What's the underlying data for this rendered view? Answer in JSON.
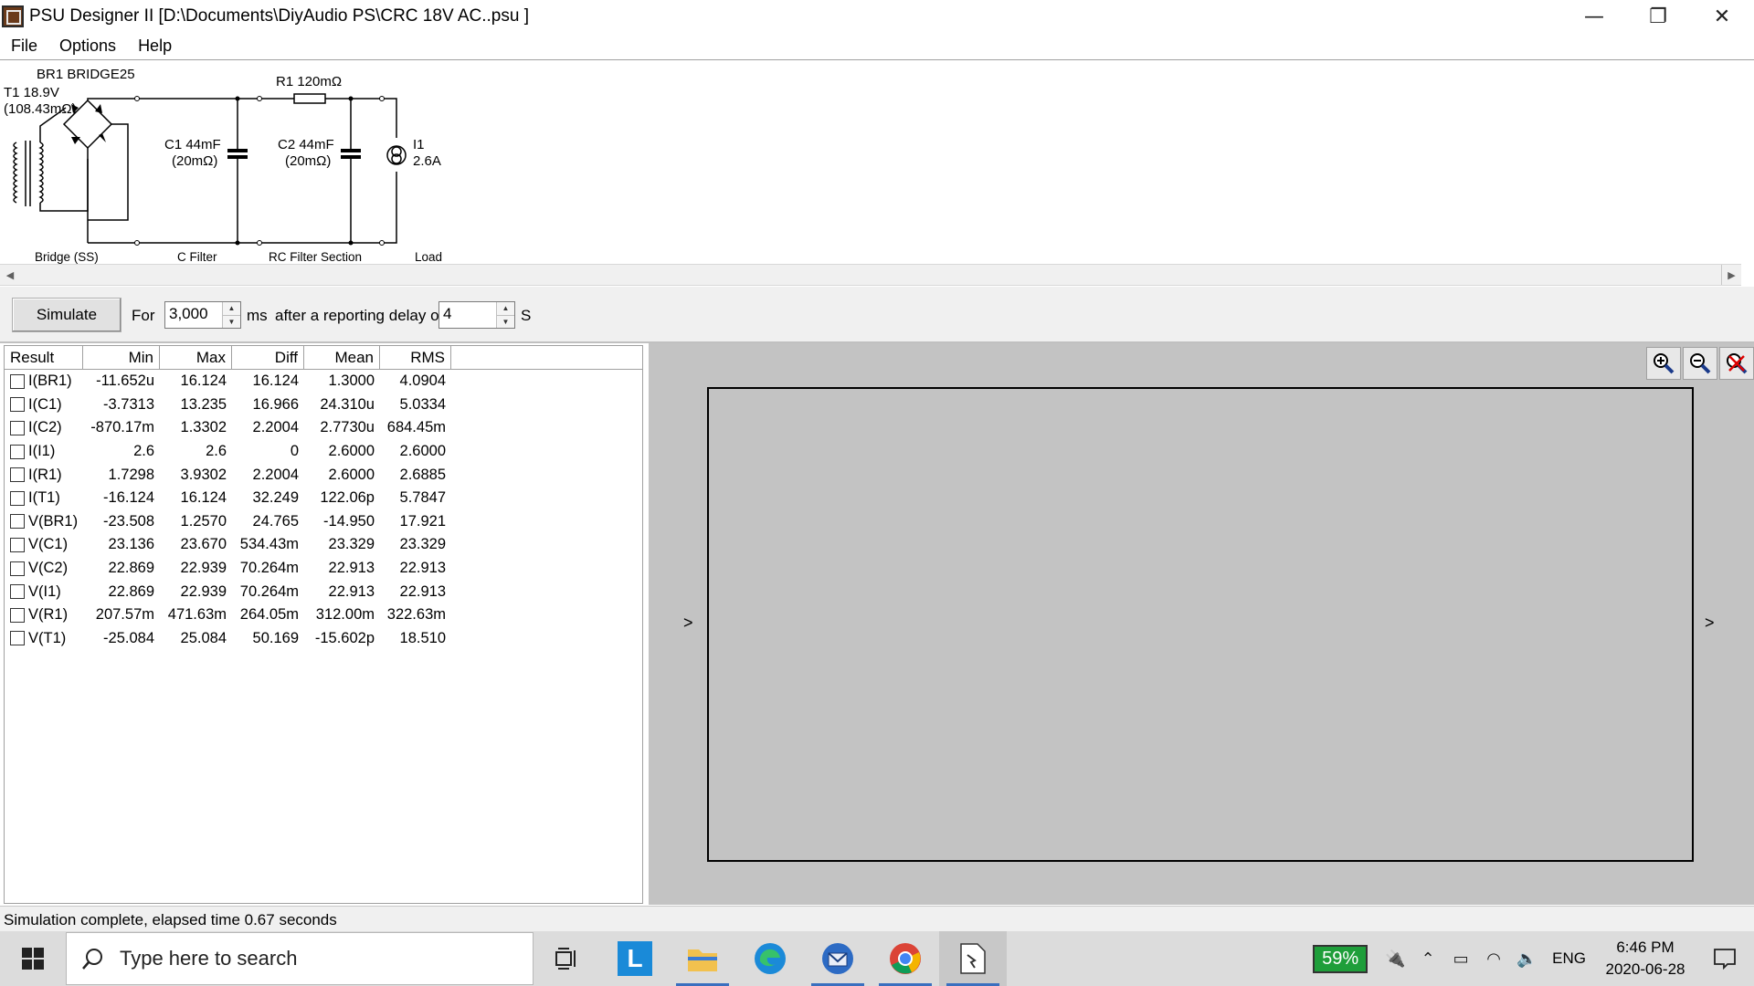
{
  "window": {
    "title": "PSU Designer II  [D:\\Documents\\DiyAudio PS\\CRC 18V AC..psu ]",
    "minimize": "—",
    "restore": "❐",
    "close": "✕"
  },
  "menu": [
    "File",
    "Options",
    "Help"
  ],
  "schematic": {
    "bridge_name": "BR1 BRIDGE25",
    "transformer": "T1 18.9V",
    "transformer_res": "(108.43mΩ)",
    "r1": "R1 120mΩ",
    "c1": "C1 44mF",
    "c1_res": "(20mΩ)",
    "c2": "C2 44mF",
    "c2_res": "(20mΩ)",
    "load_name": "I1",
    "load_value": "2.6A",
    "section_bridge": "Bridge (SS)",
    "section_cfilter": "C Filter",
    "section_rc": "RC Filter Section",
    "section_load": "Load"
  },
  "sim": {
    "button": "Simulate",
    "for_label": "For",
    "duration": "3,000",
    "ms_label": "ms",
    "delay_label": "after a reporting delay of",
    "delay": "4",
    "s_label": "S"
  },
  "results": {
    "headers": [
      "Result",
      "Min",
      "Max",
      "Diff",
      "Mean",
      "RMS"
    ],
    "rows": [
      [
        "I(BR1)",
        "-11.652u",
        "16.124",
        "16.124",
        "1.3000",
        "4.0904"
      ],
      [
        "I(C1)",
        "-3.7313",
        "13.235",
        "16.966",
        "24.310u",
        "5.0334"
      ],
      [
        "I(C2)",
        "-870.17m",
        "1.3302",
        "2.2004",
        "2.7730u",
        "684.45m"
      ],
      [
        "I(I1)",
        "2.6",
        "2.6",
        "0",
        "2.6000",
        "2.6000"
      ],
      [
        "I(R1)",
        "1.7298",
        "3.9302",
        "2.2004",
        "2.6000",
        "2.6885"
      ],
      [
        "I(T1)",
        "-16.124",
        "16.124",
        "32.249",
        "122.06p",
        "5.7847"
      ],
      [
        "V(BR1)",
        "-23.508",
        "1.2570",
        "24.765",
        "-14.950",
        "17.921"
      ],
      [
        "V(C1)",
        "23.136",
        "23.670",
        "534.43m",
        "23.329",
        "23.329"
      ],
      [
        "V(C2)",
        "22.869",
        "22.939",
        "70.264m",
        "22.913",
        "22.913"
      ],
      [
        "V(I1)",
        "22.869",
        "22.939",
        "70.264m",
        "22.913",
        "22.913"
      ],
      [
        "V(R1)",
        "207.57m",
        "471.63m",
        "264.05m",
        "312.00m",
        "322.63m"
      ],
      [
        "V(T1)",
        "-25.084",
        "25.084",
        "50.169",
        "-15.602p",
        "18.510"
      ]
    ]
  },
  "graph": {
    "left_arrow": ">",
    "right_arrow": ">"
  },
  "status": "Simulation complete, elapsed time 0.67 seconds",
  "taskbar": {
    "search_placeholder": "Type here to search",
    "battery": "59%",
    "lang": "ENG",
    "time": "6:46 PM",
    "date": "2020-06-28"
  }
}
